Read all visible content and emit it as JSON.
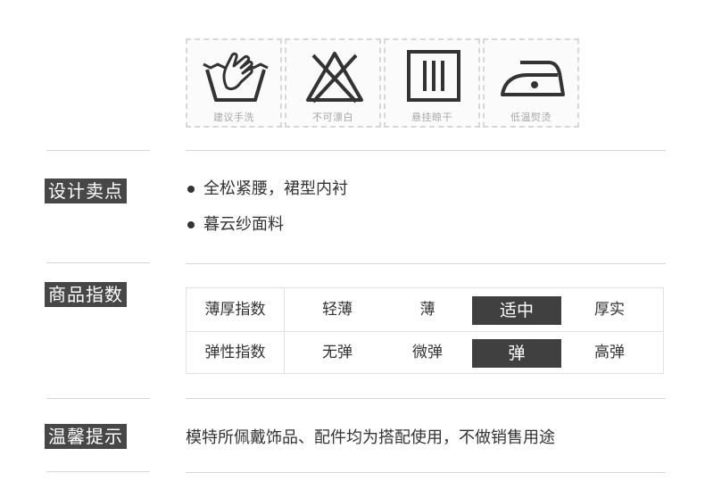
{
  "care": {
    "items": [
      {
        "label": "建议手洗",
        "icon": "hand-wash-icon"
      },
      {
        "label": "不可漂白",
        "icon": "do-not-bleach-icon"
      },
      {
        "label": "悬挂晾干",
        "icon": "line-dry-icon"
      },
      {
        "label": "低温熨烫",
        "icon": "low-iron-icon"
      }
    ]
  },
  "selling_points": {
    "label": "设计卖点",
    "items": [
      "全松紧腰，裙型内衬",
      "暮云纱面料"
    ]
  },
  "product_index": {
    "label": "商品指数",
    "rows": [
      {
        "name": "薄厚指数",
        "options": [
          "轻薄",
          "薄",
          "适中",
          "厚实"
        ],
        "selected": "适中"
      },
      {
        "name": "弹性指数",
        "options": [
          "无弹",
          "微弹",
          "弹",
          "高弹"
        ],
        "selected": "弹"
      }
    ]
  },
  "notice": {
    "label": "温馨提示",
    "text": "模特所佩戴饰品、配件均为搭配使用，不做销售用途"
  },
  "colors": {
    "label_bg": "#474747",
    "selected_bg": "#404040",
    "separator": "#d6d6d6",
    "icon_stroke": "#333333",
    "care_label": "#a6a6a6"
  }
}
